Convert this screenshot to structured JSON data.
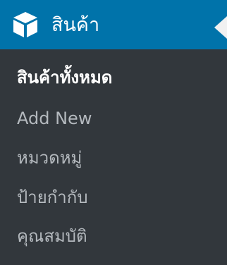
{
  "menu": {
    "icon": "box-icon",
    "title": "สินค้า",
    "submenu": [
      {
        "label": "สินค้าทั้งหมด",
        "current": true
      },
      {
        "label": "Add New",
        "current": false
      },
      {
        "label": "หมวดหมู่",
        "current": false
      },
      {
        "label": "ป้ายกำกับ",
        "current": false
      },
      {
        "label": "คุณสมบัติ",
        "current": false
      }
    ]
  },
  "colors": {
    "header_background": "#0073aa",
    "menu_background": "#32373c",
    "current_text": "#ffffff",
    "item_text": "#b4b9be"
  }
}
